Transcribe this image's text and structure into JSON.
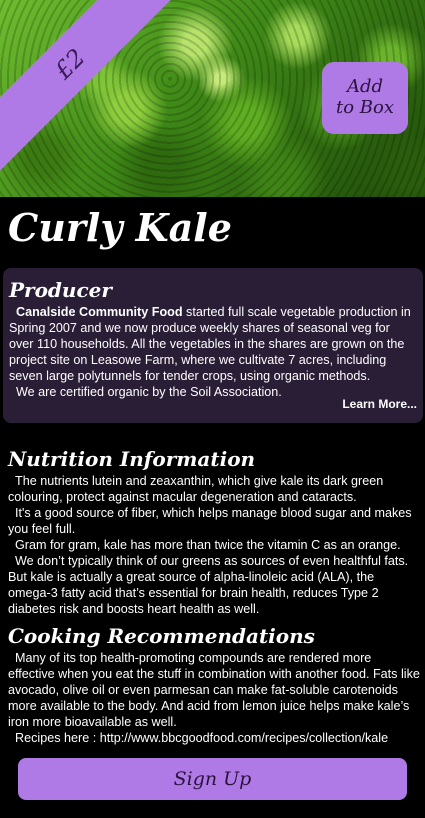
{
  "product": {
    "price": "£2",
    "add_label_line1": "Add",
    "add_label_line2": "to Box",
    "name": "Curly Kale"
  },
  "producer": {
    "title": "Producer",
    "name": "Canalside Community Food",
    "text1": " started full scale vegetable production in Spring 2007 and we now produce weekly shares of seasonal veg for over 110 households. All the vegetables in the shares are grown on the project site on Leasowe Farm, where we cultivate 7 acres, including seven large polytunnels for tender crops, using organic methods.",
    "text2": "We are certified organic by the Soil Association.",
    "learn_more": "Learn More..."
  },
  "nutrition": {
    "title": "Nutrition Information",
    "p1": "The nutrients lutein and zeaxanthin, which give kale its dark green colouring, protect against macular degeneration and cataracts.",
    "p2": "It's a good source of fiber, which helps manage blood sugar and makes you feel full.",
    "p3": "Gram for gram, kale has more than twice the vitamin C as an orange.",
    "p4": "We don’t typically think of our greens as sources of even healthful fats. But kale is actually a great source of alpha-linoleic acid (ALA), the omega-3 fatty acid that’s essential for brain health, reduces Type 2 diabetes risk and boosts heart health as well."
  },
  "cooking": {
    "title": "Cooking Recommendations",
    "p1": "Many of its top health-promoting compounds are rendered more effective when you eat the stuff in combination with another food. Fats like avocado, olive oil or even parmesan can make fat-soluble carotenoids more available to the body. And acid from lemon juice helps make kale’s iron more bioavailable as well.",
    "p2": "Recipes here : http://www.bbcgoodfood.com/recipes/collection/kale"
  },
  "signup_label": "Sign Up",
  "colors": {
    "accent": "#b07ae6",
    "panel": "#2a1d36",
    "background": "#000000"
  }
}
